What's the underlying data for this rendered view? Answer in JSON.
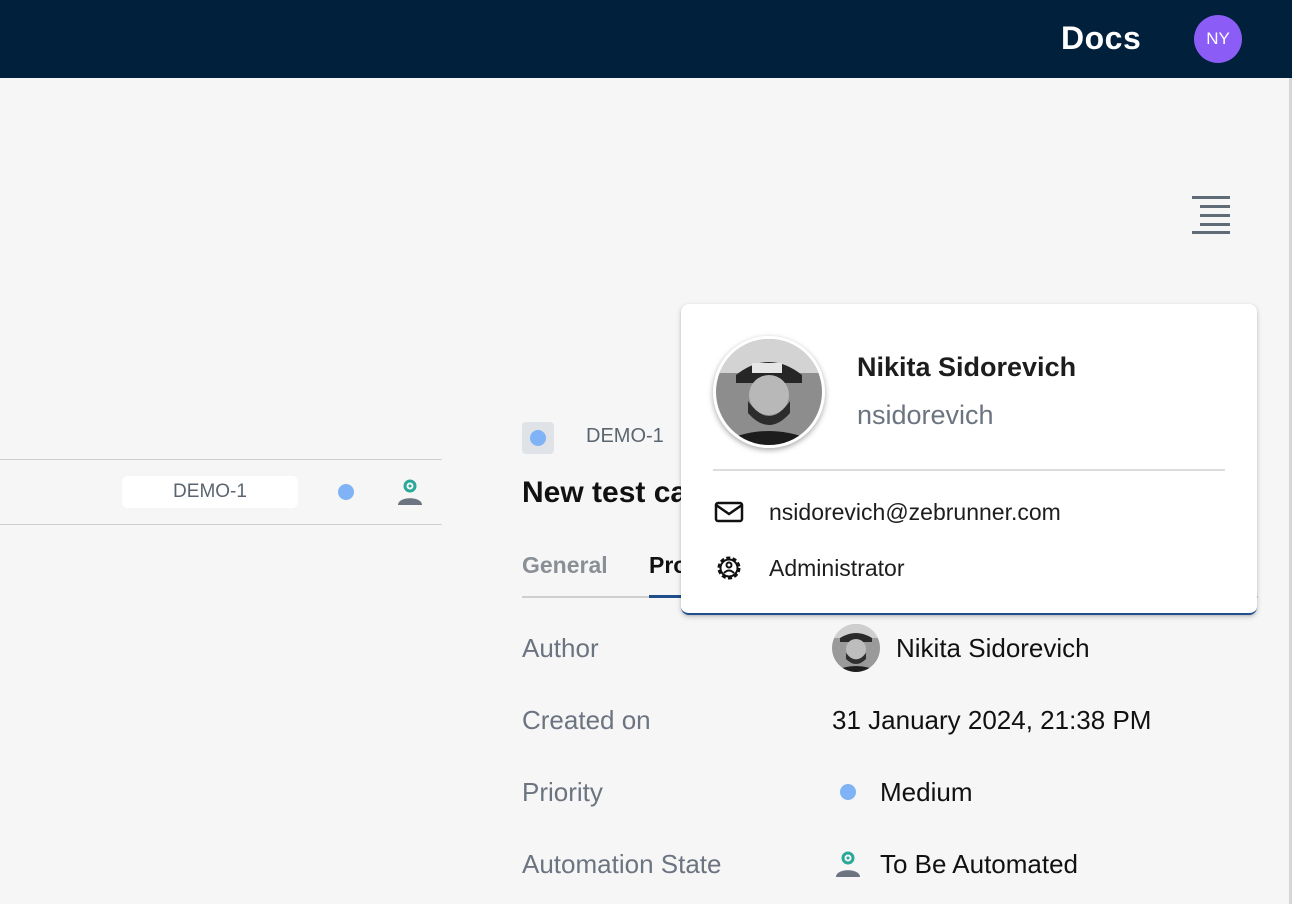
{
  "header": {
    "docs_label": "Docs",
    "avatar_initials": "NY",
    "avatar_color": "#8b5cf6",
    "background_color": "#00203b"
  },
  "list": {
    "row": {
      "key": "DEMO-1",
      "priority_icon": "dot-icon",
      "automation_icon": "automation-state-icon"
    }
  },
  "detail": {
    "key": "DEMO-1",
    "title": "New test ca",
    "tabs": [
      {
        "label": "General",
        "active": false
      },
      {
        "label": "Pro",
        "active": true
      }
    ],
    "properties": [
      {
        "label": "Author",
        "value": "Nikita Sidorevich"
      },
      {
        "label": "Created on",
        "value": "31 January 2024, 21:38 PM"
      },
      {
        "label": "Priority",
        "value": "Medium"
      },
      {
        "label": "Automation State",
        "value": "To Be Automated"
      }
    ]
  },
  "user_card": {
    "name": "Nikita Sidorevich",
    "username": "nsidorevich",
    "email": "nsidorevich@zebrunner.com",
    "role": "Administrator",
    "email_icon": "mail-icon",
    "role_icon": "gear-user-icon"
  },
  "colors": {
    "accent": "#1e4e8c",
    "priority_medium": "#7fb3f5",
    "automation": "#2aa89a"
  }
}
